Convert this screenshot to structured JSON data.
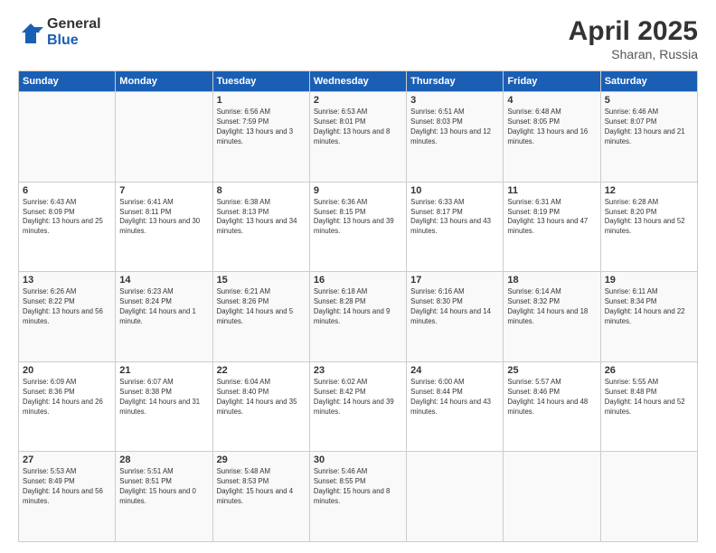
{
  "logo": {
    "general": "General",
    "blue": "Blue"
  },
  "title": {
    "month": "April 2025",
    "location": "Sharan, Russia"
  },
  "weekdays": [
    "Sunday",
    "Monday",
    "Tuesday",
    "Wednesday",
    "Thursday",
    "Friday",
    "Saturday"
  ],
  "weeks": [
    [
      {
        "day": "",
        "info": ""
      },
      {
        "day": "",
        "info": ""
      },
      {
        "day": "1",
        "info": "Sunrise: 6:56 AM\nSunset: 7:59 PM\nDaylight: 13 hours and 3 minutes."
      },
      {
        "day": "2",
        "info": "Sunrise: 6:53 AM\nSunset: 8:01 PM\nDaylight: 13 hours and 8 minutes."
      },
      {
        "day": "3",
        "info": "Sunrise: 6:51 AM\nSunset: 8:03 PM\nDaylight: 13 hours and 12 minutes."
      },
      {
        "day": "4",
        "info": "Sunrise: 6:48 AM\nSunset: 8:05 PM\nDaylight: 13 hours and 16 minutes."
      },
      {
        "day": "5",
        "info": "Sunrise: 6:46 AM\nSunset: 8:07 PM\nDaylight: 13 hours and 21 minutes."
      }
    ],
    [
      {
        "day": "6",
        "info": "Sunrise: 6:43 AM\nSunset: 8:09 PM\nDaylight: 13 hours and 25 minutes."
      },
      {
        "day": "7",
        "info": "Sunrise: 6:41 AM\nSunset: 8:11 PM\nDaylight: 13 hours and 30 minutes."
      },
      {
        "day": "8",
        "info": "Sunrise: 6:38 AM\nSunset: 8:13 PM\nDaylight: 13 hours and 34 minutes."
      },
      {
        "day": "9",
        "info": "Sunrise: 6:36 AM\nSunset: 8:15 PM\nDaylight: 13 hours and 39 minutes."
      },
      {
        "day": "10",
        "info": "Sunrise: 6:33 AM\nSunset: 8:17 PM\nDaylight: 13 hours and 43 minutes."
      },
      {
        "day": "11",
        "info": "Sunrise: 6:31 AM\nSunset: 8:19 PM\nDaylight: 13 hours and 47 minutes."
      },
      {
        "day": "12",
        "info": "Sunrise: 6:28 AM\nSunset: 8:20 PM\nDaylight: 13 hours and 52 minutes."
      }
    ],
    [
      {
        "day": "13",
        "info": "Sunrise: 6:26 AM\nSunset: 8:22 PM\nDaylight: 13 hours and 56 minutes."
      },
      {
        "day": "14",
        "info": "Sunrise: 6:23 AM\nSunset: 8:24 PM\nDaylight: 14 hours and 1 minute."
      },
      {
        "day": "15",
        "info": "Sunrise: 6:21 AM\nSunset: 8:26 PM\nDaylight: 14 hours and 5 minutes."
      },
      {
        "day": "16",
        "info": "Sunrise: 6:18 AM\nSunset: 8:28 PM\nDaylight: 14 hours and 9 minutes."
      },
      {
        "day": "17",
        "info": "Sunrise: 6:16 AM\nSunset: 8:30 PM\nDaylight: 14 hours and 14 minutes."
      },
      {
        "day": "18",
        "info": "Sunrise: 6:14 AM\nSunset: 8:32 PM\nDaylight: 14 hours and 18 minutes."
      },
      {
        "day": "19",
        "info": "Sunrise: 6:11 AM\nSunset: 8:34 PM\nDaylight: 14 hours and 22 minutes."
      }
    ],
    [
      {
        "day": "20",
        "info": "Sunrise: 6:09 AM\nSunset: 8:36 PM\nDaylight: 14 hours and 26 minutes."
      },
      {
        "day": "21",
        "info": "Sunrise: 6:07 AM\nSunset: 8:38 PM\nDaylight: 14 hours and 31 minutes."
      },
      {
        "day": "22",
        "info": "Sunrise: 6:04 AM\nSunset: 8:40 PM\nDaylight: 14 hours and 35 minutes."
      },
      {
        "day": "23",
        "info": "Sunrise: 6:02 AM\nSunset: 8:42 PM\nDaylight: 14 hours and 39 minutes."
      },
      {
        "day": "24",
        "info": "Sunrise: 6:00 AM\nSunset: 8:44 PM\nDaylight: 14 hours and 43 minutes."
      },
      {
        "day": "25",
        "info": "Sunrise: 5:57 AM\nSunset: 8:46 PM\nDaylight: 14 hours and 48 minutes."
      },
      {
        "day": "26",
        "info": "Sunrise: 5:55 AM\nSunset: 8:48 PM\nDaylight: 14 hours and 52 minutes."
      }
    ],
    [
      {
        "day": "27",
        "info": "Sunrise: 5:53 AM\nSunset: 8:49 PM\nDaylight: 14 hours and 56 minutes."
      },
      {
        "day": "28",
        "info": "Sunrise: 5:51 AM\nSunset: 8:51 PM\nDaylight: 15 hours and 0 minutes."
      },
      {
        "day": "29",
        "info": "Sunrise: 5:48 AM\nSunset: 8:53 PM\nDaylight: 15 hours and 4 minutes."
      },
      {
        "day": "30",
        "info": "Sunrise: 5:46 AM\nSunset: 8:55 PM\nDaylight: 15 hours and 8 minutes."
      },
      {
        "day": "",
        "info": ""
      },
      {
        "day": "",
        "info": ""
      },
      {
        "day": "",
        "info": ""
      }
    ]
  ]
}
